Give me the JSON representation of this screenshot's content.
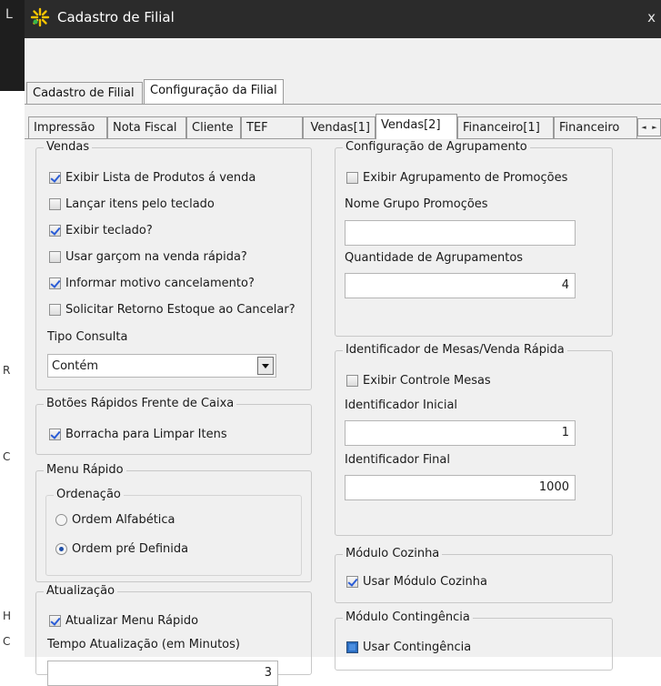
{
  "window": {
    "title": "Cadastro de Filial",
    "close_glyph": "x",
    "icon": "app-star-icon",
    "left_char": "L"
  },
  "left_edge": [
    "R",
    "C",
    "H",
    "C"
  ],
  "outer_tabs": [
    {
      "label": "Cadastro de Filial",
      "active": false
    },
    {
      "label": "Configuração da Filial",
      "active": true
    }
  ],
  "inner_tabs": [
    {
      "label": "Impressão",
      "active": false
    },
    {
      "label": "Nota Fiscal",
      "active": false
    },
    {
      "label": "Cliente",
      "active": false
    },
    {
      "label": "TEF",
      "active": false
    },
    {
      "label": "Vendas[1]",
      "active": false
    },
    {
      "label": "Vendas[2]",
      "active": true
    },
    {
      "label": "Financeiro[1]",
      "active": false
    },
    {
      "label": "Financeiro",
      "active": false
    }
  ],
  "vendas": {
    "title": "Vendas",
    "options": [
      {
        "label": "Exibir Lista de Produtos á venda",
        "checked": true
      },
      {
        "label": "Lançar itens pelo teclado",
        "checked": false
      },
      {
        "label": "Exibir teclado?",
        "checked": true
      },
      {
        "label": "Usar garçom na venda rápida?",
        "checked": false
      },
      {
        "label": "Informar motivo cancelamento?",
        "checked": true
      },
      {
        "label": "Solicitar Retorno Estoque ao Cancelar?",
        "checked": false
      }
    ],
    "tipo_consulta_label": "Tipo Consulta",
    "tipo_consulta_value": "Contém"
  },
  "botoes": {
    "title": "Botões Rápidos Frente de Caixa",
    "option": {
      "label": "Borracha para Limpar Itens",
      "checked": true
    }
  },
  "menu_rapido": {
    "title": "Menu Rápido",
    "ordenacao": "Ordenação",
    "radios": [
      {
        "label": "Ordem Alfabética",
        "selected": false
      },
      {
        "label": "Ordem pré Definida",
        "selected": true
      }
    ]
  },
  "atualizacao": {
    "title": "Atualização",
    "option": {
      "label": "Atualizar Menu Rápido",
      "checked": true
    },
    "tempo_label": "Tempo Atualização (em Minutos)",
    "tempo_value": "3"
  },
  "agrupamento": {
    "title": "Configuração de Agrupamento",
    "option": {
      "label": "Exibir Agrupamento de Promoções",
      "checked": false
    },
    "nome_label": "Nome Grupo Promoções",
    "nome_value": "",
    "qtd_label": "Quantidade de Agrupamentos",
    "qtd_value": "4"
  },
  "mesas": {
    "title": "Identificador de Mesas/Venda Rápida",
    "option": {
      "label": "Exibir Controle Mesas",
      "checked": false
    },
    "inicial_label": "Identificador Inicial",
    "inicial_value": "1",
    "final_label": "Identificador Final",
    "final_value": "1000"
  },
  "cozinha": {
    "title": "Módulo Cozinha",
    "option": {
      "label": "Usar Módulo Cozinha",
      "checked": true
    }
  },
  "contingencia": {
    "title": "Módulo Contingência",
    "option": {
      "label": "Usar Contingência",
      "state": "indeterminate"
    }
  },
  "colors": {
    "titlebar": "#2b2b2b",
    "panel": "#f0f0f0",
    "check_accent": "#2a5cd6"
  }
}
